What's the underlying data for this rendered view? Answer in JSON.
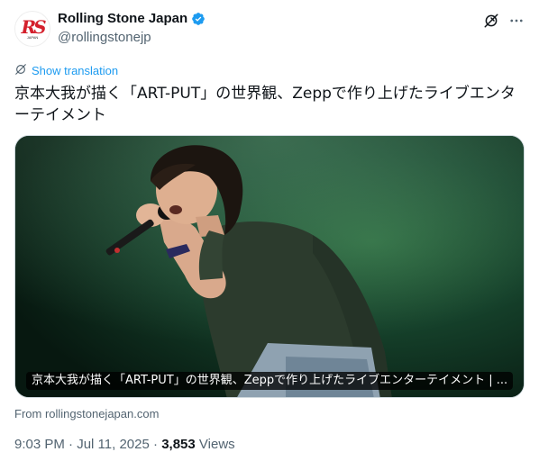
{
  "author": {
    "display_name": "Rolling Stone Japan",
    "handle": "@rollingstonejp",
    "avatar_logo": "RS",
    "avatar_sub": "JAPAN",
    "verified_icon": "verified-badge-icon"
  },
  "header_actions": {
    "grok_icon": "grok-icon",
    "more_icon": "more-icon"
  },
  "translation": {
    "icon": "translate-icon",
    "label": "Show translation"
  },
  "tweet": {
    "text": "京本大我が描く「ART-PUT」の世界観、Zeppで作り上げたライブエンターテイメント"
  },
  "card": {
    "caption": "京本大我が描く「ART-PUT」の世界観、Zeppで作り上げたライブエンターテイメント | ...",
    "source": "From rollingstonejapan.com"
  },
  "meta": {
    "time": "9:03 PM",
    "separator1": "·",
    "date": "Jul 11, 2025",
    "separator2": "·",
    "views_count": "3,853",
    "views_label": "Views"
  },
  "colors": {
    "accent": "#1d9bf0",
    "text": "#0f1419",
    "muted": "#536471",
    "brand_red": "#d4202c"
  }
}
